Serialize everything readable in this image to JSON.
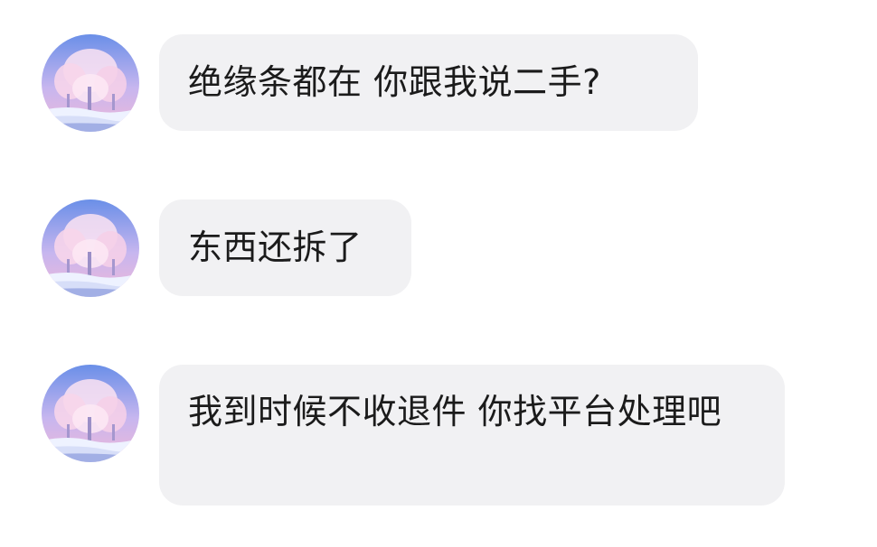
{
  "conversation": {
    "messages": [
      {
        "text": "绝缘条都在 你跟我说二手?"
      },
      {
        "text": "东西还拆了"
      },
      {
        "text": "我到时候不收退件 你找平台处理吧"
      }
    ]
  },
  "avatar": {
    "icon": "snowy-frosted-tree-photo-avatar",
    "colors": {
      "sky_top": "#6a8fe8",
      "sky_bottom": "#f0b8d8",
      "frost": "#fbe3f2",
      "snow": "#eef2ff",
      "shadow": "#7f90d8"
    }
  },
  "bubble": {
    "background": "#f1f1f3",
    "text_color": "#1b1b1b"
  }
}
